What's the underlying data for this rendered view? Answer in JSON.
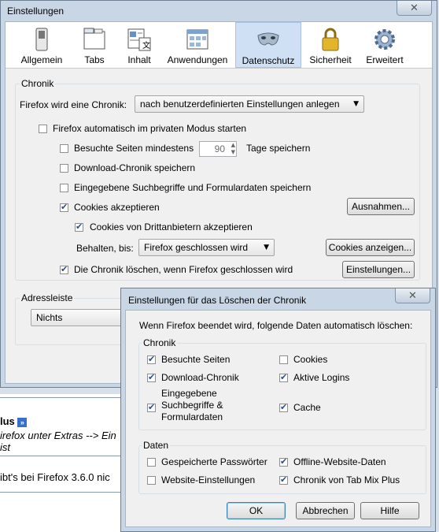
{
  "window": {
    "title": "Einstellungen",
    "close_glyph": "✕"
  },
  "toolbar": {
    "items": [
      {
        "label": "Allgemein",
        "icon": "switch-icon"
      },
      {
        "label": "Tabs",
        "icon": "tabs-icon"
      },
      {
        "label": "Inhalt",
        "icon": "content-icon"
      },
      {
        "label": "Anwendungen",
        "icon": "applications-icon"
      },
      {
        "label": "Datenschutz",
        "icon": "mask-icon",
        "selected": true
      },
      {
        "label": "Sicherheit",
        "icon": "padlock-icon"
      },
      {
        "label": "Erweitert",
        "icon": "gear-icon"
      }
    ]
  },
  "chronik": {
    "group_label": "Chronik",
    "mode_label": "Firefox wird eine Chronik:",
    "mode_value": "nach benutzerdefinierten Einstellungen anlegen",
    "private_mode": {
      "label": "Firefox automatisch im privaten Modus starten",
      "checked": false
    },
    "visited": {
      "label": "Besuchte Seiten mindestens",
      "checked": false,
      "days": "90",
      "suffix": "Tage speichern"
    },
    "downloads": {
      "label": "Download-Chronik speichern",
      "checked": false
    },
    "searches": {
      "label": "Eingegebene Suchbegriffe und Formulardaten speichern",
      "checked": false
    },
    "cookies": {
      "label": "Cookies akzeptieren",
      "checked": true,
      "exceptions_button": "Ausnahmen..."
    },
    "third_party": {
      "label": "Cookies von Drittanbietern akzeptieren",
      "checked": true
    },
    "keep": {
      "label": "Behalten, bis:",
      "value": "Firefox geschlossen wird",
      "show_cookies_button": "Cookies anzeigen..."
    },
    "clear_on_close": {
      "label": "Die Chronik löschen, wenn Firefox geschlossen wird",
      "checked": true,
      "settings_button": "Einstellungen..."
    }
  },
  "adressleiste": {
    "group_label": "Adressleiste",
    "value": "Nichts"
  },
  "background": {
    "plus_text": "lus",
    "line1": "irefox unter Extras --> Ein",
    "line2": "ist",
    "line3": "ibt's bei Firefox 3.6.0 nic"
  },
  "dialog": {
    "title": "Einstellungen für das Löschen der Chronik",
    "intro": "Wenn Firefox beendet wird, folgende Daten automatisch löschen:",
    "chronik_label": "Chronik",
    "chronik_items": [
      {
        "label": "Besuchte Seiten",
        "checked": true
      },
      {
        "label": "Cookies",
        "checked": false
      },
      {
        "label": "Download-Chronik",
        "checked": true
      },
      {
        "label": "Aktive Logins",
        "checked": true
      },
      {
        "label": "Eingegebene Suchbegriffe & Formulardaten",
        "checked": true
      },
      {
        "label": "Cache",
        "checked": true
      }
    ],
    "searches_line1": "Eingegebene",
    "searches_line2": "Suchbegriffe &",
    "searches_line3": "Formulardaten",
    "daten_label": "Daten",
    "daten_items": [
      {
        "label": "Gespeicherte Passwörter",
        "checked": false
      },
      {
        "label": "Offline-Website-Daten",
        "checked": true
      },
      {
        "label": "Website-Einstellungen",
        "checked": false
      },
      {
        "label": "Chronik von Tab Mix Plus",
        "checked": true
      }
    ],
    "ok": "OK",
    "cancel": "Abbrechen",
    "help": "Hilfe"
  }
}
